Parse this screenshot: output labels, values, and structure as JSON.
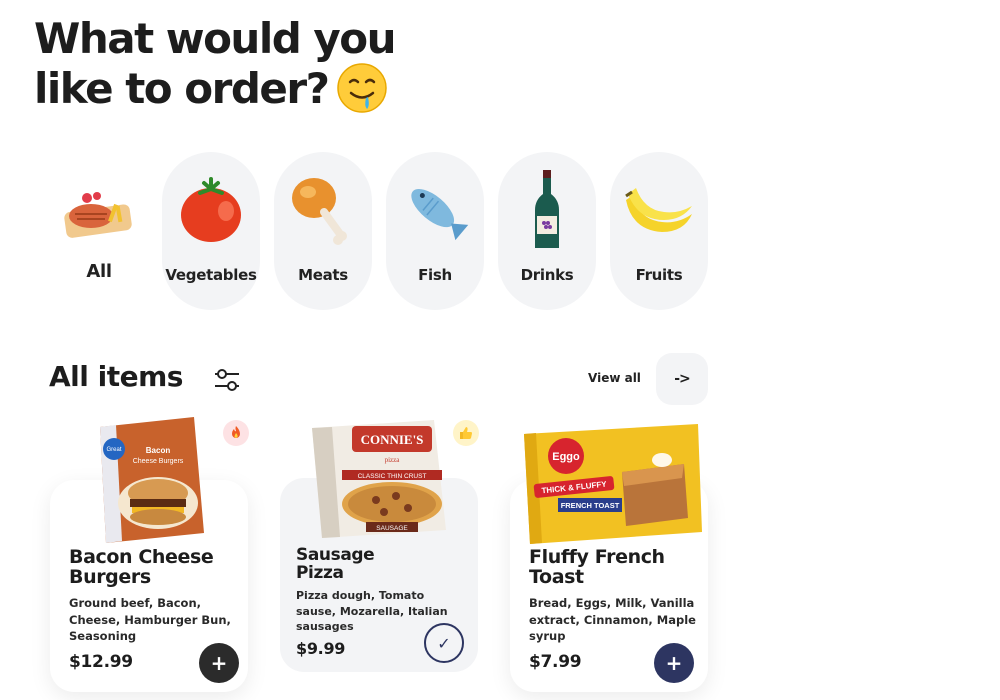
{
  "header": {
    "line1": "What would you",
    "line2": "like to order?",
    "emoji_icon": "drooling-face-icon"
  },
  "categories": [
    {
      "label": "All",
      "icon": "steak-plate-icon",
      "active": true
    },
    {
      "label": "Vegetables",
      "icon": "tomato-icon",
      "active": false
    },
    {
      "label": "Meats",
      "icon": "chicken-leg-icon",
      "active": false
    },
    {
      "label": "Fish",
      "icon": "fish-icon",
      "active": false
    },
    {
      "label": "Drinks",
      "icon": "wine-bottle-icon",
      "active": false
    },
    {
      "label": "Fruits",
      "icon": "banana-icon",
      "active": false
    }
  ],
  "section": {
    "title": "All items",
    "filter_icon": "filter-sliders-icon",
    "view_all": "View all",
    "arrow_icon": "arrow-right-icon",
    "arrow_text": "->"
  },
  "items": [
    {
      "title_line1": "Bacon Cheese",
      "title_line2": "Burgers",
      "desc_lines": [
        "Ground beef, Bacon,",
        "Cheese, Hamburger Bun,",
        "Seasoning"
      ],
      "price": "$12.99",
      "badge_icon": "fire-icon",
      "badge_color": "#fde2e4",
      "action": "add",
      "action_label": "+",
      "action_color": "#2b2b2b",
      "box_text": [
        "Great",
        "Value",
        "Bacon",
        "Cheese Burgers"
      ]
    },
    {
      "title_line1": "Sausage",
      "title_line2": "Pizza",
      "desc_lines": [
        "Pizza dough, Tomato",
        "sause, Mozarella, Italian",
        "sausages"
      ],
      "price": "$9.99",
      "badge_icon": "thumbs-up-icon",
      "badge_color": "#fff4c8",
      "action": "added",
      "action_label": "✓",
      "action_color": "#2d3561",
      "box_text": [
        "CONNIE'S",
        "pizza",
        "CLASSIC THIN CRUST",
        "SAUSAGE"
      ]
    },
    {
      "title_line1": "Fluffy French",
      "title_line2": "Toast",
      "desc_lines": [
        "Bread, Eggs, Milk, Vanilla",
        "extract, Cinnamon, Maple",
        "syrup"
      ],
      "price": "$7.99",
      "badge_icon": "",
      "badge_color": "",
      "action": "add",
      "action_label": "+",
      "action_color": "#2d3561",
      "box_text": [
        "Eggo",
        "THICK & FLUFFY",
        "FRENCH TOAST"
      ]
    }
  ],
  "colors": {
    "background": "#ffffff",
    "category_bg": "#f3f4f6",
    "text": "#1d1d1d",
    "navy": "#2d3561"
  }
}
